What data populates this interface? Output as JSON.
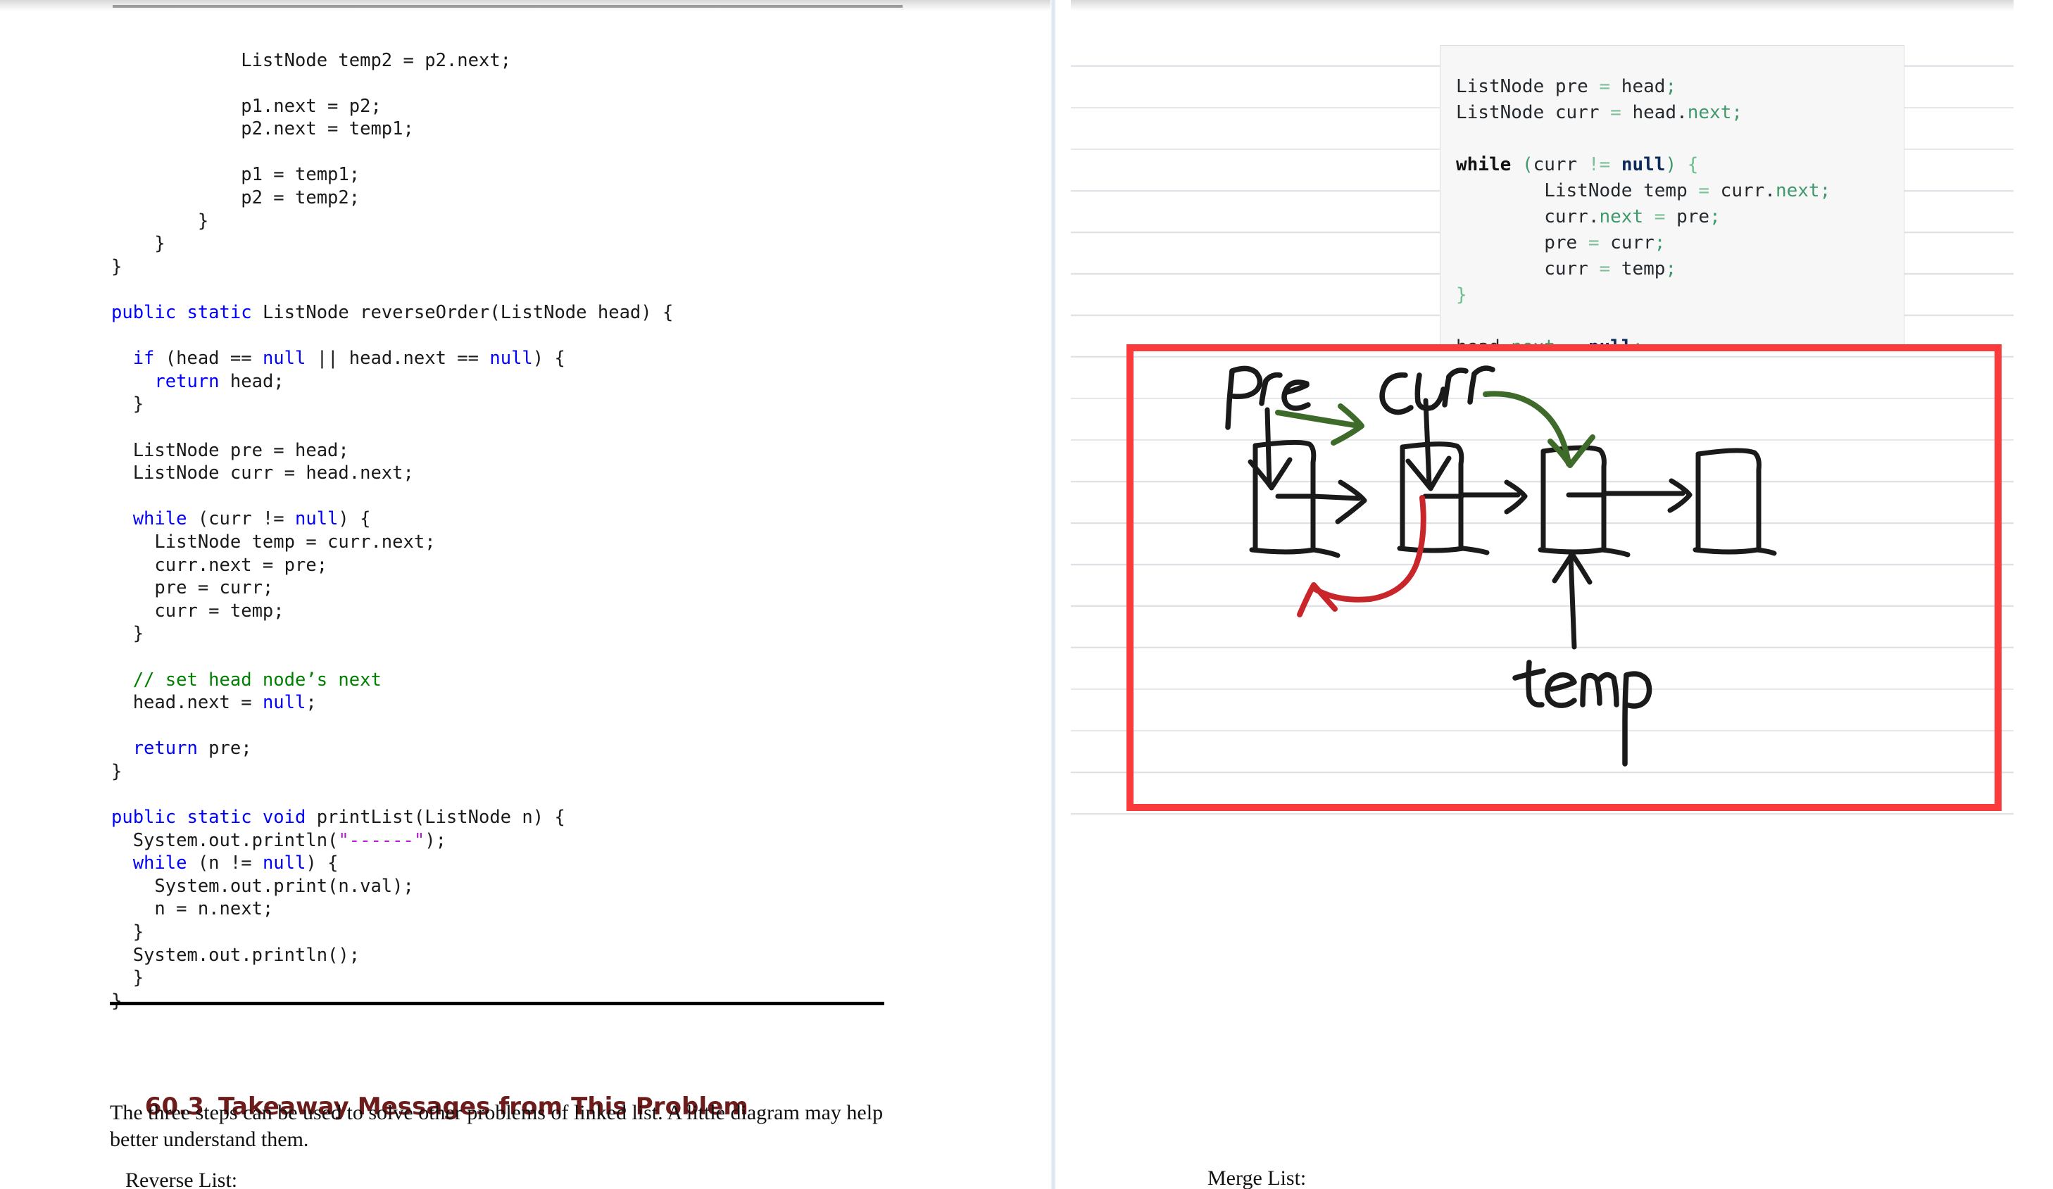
{
  "document": {
    "left_page": {
      "code_lines": [
        {
          "indent": 6,
          "segments": [
            {
              "t": "ListNode temp2 = p2.next;",
              "c": "plain"
            }
          ]
        },
        {
          "indent": 0,
          "segments": []
        },
        {
          "indent": 6,
          "segments": [
            {
              "t": "p1.next = p2;",
              "c": "plain"
            }
          ]
        },
        {
          "indent": 6,
          "segments": [
            {
              "t": "p2.next = temp1;",
              "c": "plain"
            }
          ]
        },
        {
          "indent": 0,
          "segments": []
        },
        {
          "indent": 6,
          "segments": [
            {
              "t": "p1 = temp1;",
              "c": "plain"
            }
          ]
        },
        {
          "indent": 6,
          "segments": [
            {
              "t": "p2 = temp2;",
              "c": "plain"
            }
          ]
        },
        {
          "indent": 4,
          "segments": [
            {
              "t": "}",
              "c": "plain"
            }
          ]
        },
        {
          "indent": 2,
          "segments": [
            {
              "t": "}",
              "c": "plain"
            }
          ]
        },
        {
          "indent": 0,
          "segments": [
            {
              "t": "}",
              "c": "plain"
            }
          ]
        },
        {
          "indent": 0,
          "segments": []
        },
        {
          "indent": 0,
          "segments": [
            {
              "t": "public static",
              "c": "kw"
            },
            {
              "t": " ListNode reverseOrder(ListNode head) {",
              "c": "plain"
            }
          ]
        },
        {
          "indent": 0,
          "segments": []
        },
        {
          "indent": 1,
          "segments": [
            {
              "t": "if",
              "c": "kw"
            },
            {
              "t": " (head == ",
              "c": "plain"
            },
            {
              "t": "null",
              "c": "kw"
            },
            {
              "t": " || head.next == ",
              "c": "plain"
            },
            {
              "t": "null",
              "c": "kw"
            },
            {
              "t": ") {",
              "c": "plain"
            }
          ]
        },
        {
          "indent": 2,
          "segments": [
            {
              "t": "return",
              "c": "kw"
            },
            {
              "t": " head;",
              "c": "plain"
            }
          ]
        },
        {
          "indent": 1,
          "segments": [
            {
              "t": "}",
              "c": "plain"
            }
          ]
        },
        {
          "indent": 0,
          "segments": []
        },
        {
          "indent": 1,
          "segments": [
            {
              "t": "ListNode pre = head;",
              "c": "plain"
            }
          ]
        },
        {
          "indent": 1,
          "segments": [
            {
              "t": "ListNode curr = head.next;",
              "c": "plain"
            }
          ]
        },
        {
          "indent": 0,
          "segments": []
        },
        {
          "indent": 1,
          "segments": [
            {
              "t": "while",
              "c": "kw"
            },
            {
              "t": " (curr != ",
              "c": "plain"
            },
            {
              "t": "null",
              "c": "kw"
            },
            {
              "t": ") {",
              "c": "plain"
            }
          ]
        },
        {
          "indent": 2,
          "segments": [
            {
              "t": "ListNode temp = curr.next;",
              "c": "plain"
            }
          ]
        },
        {
          "indent": 2,
          "segments": [
            {
              "t": "curr.next = pre;",
              "c": "plain"
            }
          ]
        },
        {
          "indent": 2,
          "segments": [
            {
              "t": "pre = curr;",
              "c": "plain"
            }
          ]
        },
        {
          "indent": 2,
          "segments": [
            {
              "t": "curr = temp;",
              "c": "plain"
            }
          ]
        },
        {
          "indent": 1,
          "segments": [
            {
              "t": "}",
              "c": "plain"
            }
          ]
        },
        {
          "indent": 0,
          "segments": []
        },
        {
          "indent": 1,
          "segments": [
            {
              "t": "// set head node’s next",
              "c": "cmt"
            }
          ]
        },
        {
          "indent": 1,
          "segments": [
            {
              "t": "head.next = ",
              "c": "plain"
            },
            {
              "t": "null",
              "c": "kw"
            },
            {
              "t": ";",
              "c": "plain"
            }
          ]
        },
        {
          "indent": 0,
          "segments": []
        },
        {
          "indent": 1,
          "segments": [
            {
              "t": "return",
              "c": "kw"
            },
            {
              "t": " pre;",
              "c": "plain"
            }
          ]
        },
        {
          "indent": 0,
          "segments": [
            {
              "t": "}",
              "c": "plain"
            }
          ]
        },
        {
          "indent": 0,
          "segments": []
        },
        {
          "indent": 0,
          "segments": [
            {
              "t": "public static void",
              "c": "kw"
            },
            {
              "t": " printList(ListNode n) {",
              "c": "plain"
            }
          ]
        },
        {
          "indent": 1,
          "segments": [
            {
              "t": "System.out.println(",
              "c": "plain"
            },
            {
              "t": "\"------\"",
              "c": "str"
            },
            {
              "t": ");",
              "c": "plain"
            }
          ]
        },
        {
          "indent": 1,
          "segments": [
            {
              "t": "while",
              "c": "kw"
            },
            {
              "t": " (n != ",
              "c": "plain"
            },
            {
              "t": "null",
              "c": "kw"
            },
            {
              "t": ") {",
              "c": "plain"
            }
          ]
        },
        {
          "indent": 2,
          "segments": [
            {
              "t": "System.out.print(n.val);",
              "c": "plain"
            }
          ]
        },
        {
          "indent": 2,
          "segments": [
            {
              "t": "n = n.next;",
              "c": "plain"
            }
          ]
        },
        {
          "indent": 1,
          "segments": [
            {
              "t": "}",
              "c": "plain"
            }
          ]
        },
        {
          "indent": 1,
          "segments": [
            {
              "t": "System.out.println();",
              "c": "plain"
            }
          ]
        },
        {
          "indent": 0,
          "segments": [
            {
              "t": "  }",
              "c": "plain"
            }
          ]
        },
        {
          "indent": 0,
          "segments": [
            {
              "t": "}",
              "c": "plain"
            }
          ]
        }
      ],
      "section": {
        "number": "60.3",
        "title": "Takeaway Messages from This Problem"
      },
      "paragraph_1": "The three steps can be used to solve other problems of linked list.  A little diagram may help better understand them.",
      "paragraph_2": "Reverse List:"
    },
    "right_page": {
      "code_screenshot": {
        "lines": [
          [
            {
              "t": "ListNode pre ",
              "c": "plain"
            },
            {
              "t": "=",
              "c": "op"
            },
            {
              "t": " head",
              "c": "plain"
            },
            {
              "t": ";",
              "c": "prop"
            }
          ],
          [
            {
              "t": "ListNode curr ",
              "c": "plain"
            },
            {
              "t": "=",
              "c": "op"
            },
            {
              "t": " head.",
              "c": "plain"
            },
            {
              "t": "next",
              "c": "prop"
            },
            {
              "t": ";",
              "c": "prop"
            }
          ],
          [],
          [
            {
              "t": "while",
              "c": "kw"
            },
            {
              "t": " ",
              "c": "plain"
            },
            {
              "t": "(",
              "c": "prop"
            },
            {
              "t": "curr ",
              "c": "plain"
            },
            {
              "t": "!=",
              "c": "op"
            },
            {
              "t": " ",
              "c": "plain"
            },
            {
              "t": "null",
              "c": "nul"
            },
            {
              "t": ")",
              "c": "prop"
            },
            {
              "t": " ",
              "c": "plain"
            },
            {
              "t": "{",
              "c": "brc"
            }
          ],
          [
            {
              "t": "        ListNode temp ",
              "c": "plain"
            },
            {
              "t": "=",
              "c": "op"
            },
            {
              "t": " curr.",
              "c": "plain"
            },
            {
              "t": "next",
              "c": "prop"
            },
            {
              "t": ";",
              "c": "prop"
            }
          ],
          [
            {
              "t": "        curr.",
              "c": "plain"
            },
            {
              "t": "next",
              "c": "prop"
            },
            {
              "t": " ",
              "c": "plain"
            },
            {
              "t": "=",
              "c": "op"
            },
            {
              "t": " pre",
              "c": "plain"
            },
            {
              "t": ";",
              "c": "prop"
            }
          ],
          [
            {
              "t": "        pre ",
              "c": "plain"
            },
            {
              "t": "=",
              "c": "op"
            },
            {
              "t": " curr",
              "c": "plain"
            },
            {
              "t": ";",
              "c": "prop"
            }
          ],
          [
            {
              "t": "        curr ",
              "c": "plain"
            },
            {
              "t": "=",
              "c": "op"
            },
            {
              "t": " temp",
              "c": "plain"
            },
            {
              "t": ";",
              "c": "prop"
            }
          ],
          [
            {
              "t": "}",
              "c": "brc"
            }
          ],
          [],
          [
            {
              "t": "head.",
              "c": "plain"
            },
            {
              "t": "next",
              "c": "prop"
            },
            {
              "t": " ",
              "c": "plain"
            },
            {
              "t": "=",
              "c": "op"
            },
            {
              "t": " ",
              "c": "plain"
            },
            {
              "t": "null",
              "c": "nul"
            },
            {
              "t": ";",
              "c": "prop"
            }
          ]
        ]
      },
      "diagram": {
        "labels": {
          "pre": "pre",
          "curr": "curr",
          "temp": "temp"
        },
        "node_count": 4,
        "arrow_colors": {
          "pointer": "#1a1a1a",
          "advance": "#3e6b29",
          "relink": "#c8262b"
        }
      },
      "merge_label": "Merge List:"
    },
    "highlight_box_color": "#fb3b3b"
  }
}
